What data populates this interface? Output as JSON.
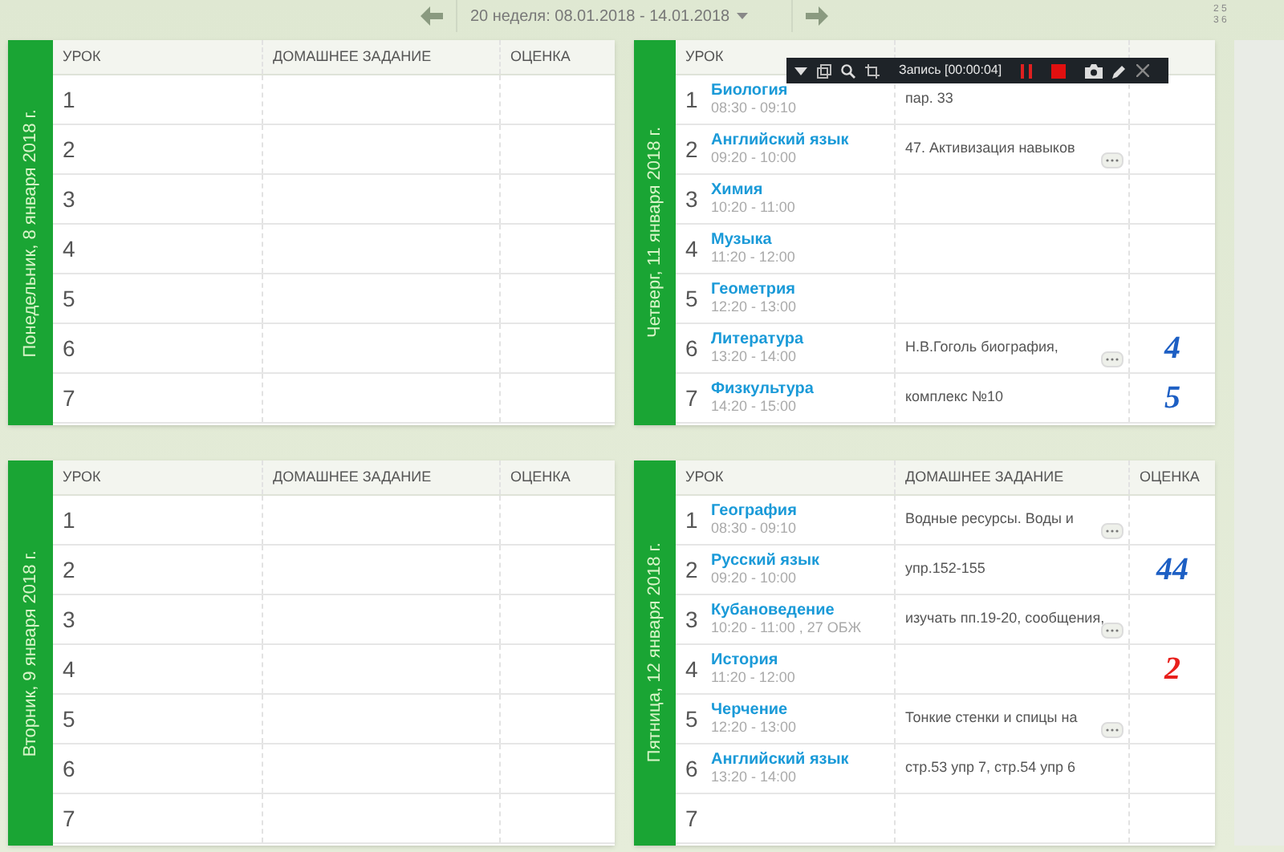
{
  "week_nav": {
    "label": "20 неделя: 08.01.2018 - 14.01.2018",
    "corner_digits": [
      "2 5",
      "3 6"
    ]
  },
  "days": [
    {
      "date": "Понедельник, 8 января 2018 г.",
      "columns": [
        "УРОК",
        "ДОМАШНЕЕ ЗАДАНИЕ",
        "ОЦЕНКА"
      ],
      "lessons": [
        {
          "number": "1"
        },
        {
          "number": "2"
        },
        {
          "number": "3"
        },
        {
          "number": "4"
        },
        {
          "number": "5"
        },
        {
          "number": "6"
        },
        {
          "number": "7"
        }
      ]
    },
    {
      "date": "Четверг, 11 января 2018 г.",
      "columns": [
        "УРОК"
      ],
      "lessons": [
        {
          "number": "1",
          "subject": "Биология",
          "time": "08:30 - 09:10",
          "homework": "пар. 33",
          "more": false
        },
        {
          "number": "2",
          "subject": "Английский язык",
          "time": "09:20 - 10:00",
          "homework": "47. Активизация навыков",
          "more": true
        },
        {
          "number": "3",
          "subject": "Химия",
          "time": "10:20 - 11:00"
        },
        {
          "number": "4",
          "subject": "Музыка",
          "time": "11:20 - 12:00"
        },
        {
          "number": "5",
          "subject": "Геометрия",
          "time": "12:20 - 13:00"
        },
        {
          "number": "6",
          "subject": "Литература",
          "time": "13:20 - 14:00",
          "homework": "Н.В.Гоголь биография,",
          "more": true,
          "grade": {
            "text": "4",
            "color": "#1d5fc4"
          }
        },
        {
          "number": "7",
          "subject": "Физкультура",
          "time": "14:20 - 15:00",
          "homework": "комплекс №10",
          "more": false,
          "grade": {
            "text": "5",
            "color": "#1d5fc4"
          }
        }
      ]
    },
    {
      "date": "Вторник, 9 января 2018 г.",
      "columns": [
        "УРОК",
        "ДОМАШНЕЕ ЗАДАНИЕ",
        "ОЦЕНКА"
      ],
      "lessons": [
        {
          "number": "1"
        },
        {
          "number": "2"
        },
        {
          "number": "3"
        },
        {
          "number": "4"
        },
        {
          "number": "5"
        },
        {
          "number": "6"
        },
        {
          "number": "7"
        }
      ]
    },
    {
      "date": "Пятница, 12 января 2018 г.",
      "columns": [
        "УРОК",
        "ДОМАШНЕЕ ЗАДАНИЕ",
        "ОЦЕНКА"
      ],
      "lessons": [
        {
          "number": "1",
          "subject": "География",
          "time": "08:30 - 09:10",
          "homework": "Водные ресурсы. Воды и",
          "more": true
        },
        {
          "number": "2",
          "subject": "Русский язык",
          "time": "09:20 - 10:00",
          "homework": "упр.152-155",
          "more": false,
          "grade": {
            "text": "44",
            "color": "#1d5fc4"
          }
        },
        {
          "number": "3",
          "subject": "Кубановедение",
          "time": "10:20 - 11:00 , 27 ОБЖ",
          "homework": "изучать пп.19-20, сообщения,",
          "more": true
        },
        {
          "number": "4",
          "subject": "История",
          "time": "11:20 - 12:00",
          "grade": {
            "text": "2",
            "color": "#e8201c"
          }
        },
        {
          "number": "5",
          "subject": "Черчение",
          "time": "12:20 - 13:00",
          "homework": "Тонкие стенки и спицы на",
          "more": true
        },
        {
          "number": "6",
          "subject": "Английский язык",
          "time": "13:20 - 14:00",
          "homework": "стр.53 упр 7, стр.54 упр 6",
          "more": false
        },
        {
          "number": "7"
        }
      ]
    }
  ],
  "recorder": {
    "status": "Запись [00:00:04]"
  }
}
